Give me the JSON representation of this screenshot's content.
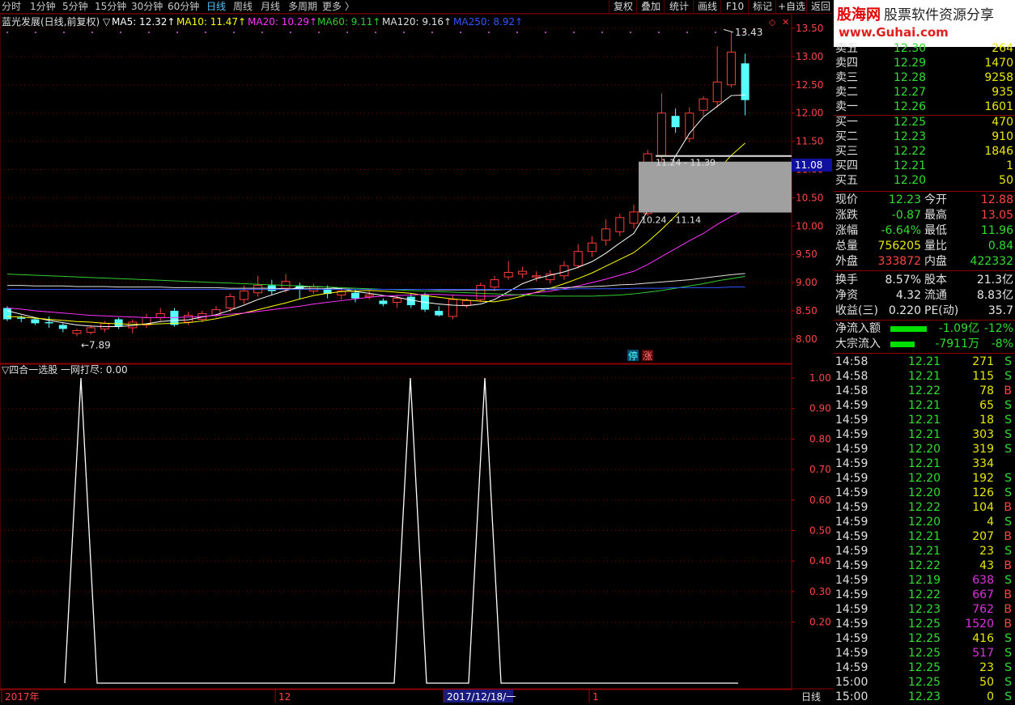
{
  "toolbar": {
    "periods": [
      "分时",
      "1分钟",
      "5分钟",
      "15分钟",
      "30分钟",
      "60分钟",
      "日线",
      "周线",
      "月线",
      "多周期",
      "更多 〉"
    ],
    "active_period": "日线",
    "buttons": [
      "复权",
      "叠加",
      "统计",
      "画线",
      "F10",
      "标记",
      "+自选",
      "返回"
    ]
  },
  "logo": {
    "brand": "股海网",
    "slogan": "股票软件资源分享",
    "url": "www.Guhai.com"
  },
  "chart_header": {
    "title": "蓝光发展(日线,前复权) ▽",
    "ma": [
      {
        "label": "MA5: 12.32↑",
        "color": "#ffffff"
      },
      {
        "label": "MA10: 11.47↑",
        "color": "#ffff00"
      },
      {
        "label": "MA20: 10.29↑",
        "color": "#ff33ff"
      },
      {
        "label": "MA60: 9.11↑",
        "color": "#33cc33"
      },
      {
        "label": "MA120: 9.16↑",
        "color": "#e0e0e0"
      },
      {
        "label": "MA250: 8.92↑",
        "color": "#3355ff"
      }
    ]
  },
  "chart_annotations": {
    "high_label": "13.43",
    "low_label": "←7.89",
    "price_marker": "11.08",
    "zone_top_label": "11.24 - 11.39",
    "zone_bottom_label": "10.24 - 11.14",
    "badge_stop": "停",
    "badge_rise": "涨"
  },
  "chart_data": [
    {
      "type": "candlestick",
      "title": "蓝光发展(日线,前复权)",
      "yticks": [
        "13.50",
        "13.00",
        "12.50",
        "12.00",
        "11.50",
        "11.00",
        "10.50",
        "10.00",
        "9.50",
        "9.00",
        "8.50",
        "8.00"
      ],
      "ylim": [
        7.8,
        13.6
      ],
      "x_labels": [
        "2017年",
        "12",
        "2017/12/18/一",
        "1"
      ],
      "candles": [
        [
          8.55,
          8.35,
          8.58,
          8.32
        ],
        [
          8.38,
          8.36,
          8.42,
          8.3
        ],
        [
          8.35,
          8.28,
          8.38,
          8.25
        ],
        [
          8.3,
          8.28,
          8.4,
          8.2
        ],
        [
          8.25,
          8.18,
          8.28,
          8.12
        ],
        [
          8.1,
          8.15,
          8.18,
          8.05
        ],
        [
          8.12,
          8.2,
          8.25,
          8.08
        ],
        [
          8.18,
          8.28,
          8.32,
          8.12
        ],
        [
          8.35,
          8.22,
          8.38,
          8.18
        ],
        [
          8.2,
          8.3,
          8.35,
          8.1
        ],
        [
          8.25,
          8.38,
          8.45,
          8.2
        ],
        [
          8.38,
          8.45,
          8.55,
          8.32
        ],
        [
          8.5,
          8.25,
          8.55,
          8.22
        ],
        [
          8.3,
          8.42,
          8.48,
          8.25
        ],
        [
          8.35,
          8.45,
          8.5,
          8.3
        ],
        [
          8.42,
          8.52,
          8.58,
          8.38
        ],
        [
          8.55,
          8.75,
          8.8,
          8.48
        ],
        [
          8.7,
          8.85,
          8.95,
          8.62
        ],
        [
          8.82,
          8.95,
          9.12,
          8.75
        ],
        [
          8.95,
          8.85,
          9.05,
          8.78
        ],
        [
          8.9,
          9.02,
          9.15,
          8.82
        ],
        [
          8.95,
          8.88,
          9.0,
          8.7
        ],
        [
          8.85,
          8.92,
          8.98,
          8.8
        ],
        [
          8.9,
          8.8,
          8.95,
          8.72
        ],
        [
          8.78,
          8.85,
          8.92,
          8.7
        ],
        [
          8.82,
          8.72,
          8.88,
          8.65
        ],
        [
          8.75,
          8.78,
          8.85,
          8.7
        ],
        [
          8.68,
          8.62,
          8.72,
          8.58
        ],
        [
          8.65,
          8.72,
          8.78,
          8.55
        ],
        [
          8.75,
          8.6,
          8.8,
          8.55
        ],
        [
          8.78,
          8.52,
          8.82,
          8.48
        ],
        [
          8.5,
          8.42,
          8.58,
          8.4
        ],
        [
          8.4,
          8.7,
          8.78,
          8.35
        ],
        [
          8.6,
          8.68,
          8.72,
          8.55
        ],
        [
          8.7,
          8.95,
          9.0,
          8.65
        ],
        [
          8.92,
          9.05,
          9.12,
          8.85
        ],
        [
          9.1,
          9.18,
          9.38,
          9.05
        ],
        [
          9.15,
          9.2,
          9.28,
          9.08
        ],
        [
          9.1,
          9.12,
          9.2,
          9.02
        ],
        [
          9.05,
          9.15,
          9.22,
          8.98
        ],
        [
          9.12,
          9.3,
          9.38,
          9.05
        ],
        [
          9.3,
          9.55,
          9.68,
          9.25
        ],
        [
          9.55,
          9.7,
          9.82,
          9.45
        ],
        [
          9.75,
          9.95,
          10.12,
          9.65
        ],
        [
          9.9,
          10.15,
          10.22,
          9.82
        ],
        [
          10.05,
          10.25,
          10.38,
          9.95
        ],
        [
          10.22,
          11.28,
          11.35,
          10.18
        ],
        [
          11.25,
          12.0,
          12.35,
          11.1
        ],
        [
          11.95,
          11.75,
          12.08,
          11.65
        ],
        [
          11.55,
          12.0,
          12.1,
          11.48
        ],
        [
          12.05,
          12.25,
          12.3,
          11.95
        ],
        [
          12.2,
          12.55,
          13.18,
          12.1
        ],
        [
          12.5,
          13.08,
          13.43,
          12.45
        ],
        [
          12.88,
          12.23,
          13.05,
          11.96
        ]
      ],
      "series": [
        {
          "name": "MA5",
          "values": [
            8.5,
            8.44,
            8.38,
            8.33,
            8.29,
            8.25,
            8.23,
            8.22,
            8.22,
            8.24,
            8.27,
            8.31,
            8.33,
            8.34,
            8.39,
            8.43,
            8.51,
            8.6,
            8.7,
            8.78,
            8.86,
            8.92,
            8.93,
            8.92,
            8.89,
            8.84,
            8.81,
            8.77,
            8.74,
            8.69,
            8.65,
            8.62,
            8.6,
            8.59,
            8.62,
            8.7,
            8.84,
            8.98,
            9.07,
            9.13,
            9.19,
            9.27,
            9.37,
            9.52,
            9.7,
            9.87,
            10.27,
            10.81,
            11.24,
            11.64,
            11.93,
            12.12,
            12.31,
            12.32
          ]
        },
        {
          "name": "MA10",
          "values": [
            8.4,
            8.39,
            8.37,
            8.35,
            8.33,
            8.31,
            8.3,
            8.28,
            8.27,
            8.26,
            8.26,
            8.27,
            8.28,
            8.29,
            8.32,
            8.36,
            8.41,
            8.46,
            8.52,
            8.58,
            8.64,
            8.71,
            8.77,
            8.81,
            8.84,
            8.85,
            8.86,
            8.85,
            8.83,
            8.81,
            8.77,
            8.74,
            8.71,
            8.69,
            8.67,
            8.66,
            8.7,
            8.76,
            8.83,
            8.9,
            8.98,
            9.07,
            9.17,
            9.29,
            9.41,
            9.53,
            9.72,
            9.94,
            10.18,
            10.43,
            10.66,
            10.98,
            11.25,
            11.47
          ]
        },
        {
          "name": "MA20",
          "values": [
            8.55,
            8.53,
            8.5,
            8.48,
            8.46,
            8.44,
            8.42,
            8.41,
            8.4,
            8.39,
            8.38,
            8.38,
            8.38,
            8.39,
            8.4,
            8.42,
            8.44,
            8.46,
            8.49,
            8.52,
            8.55,
            8.58,
            8.62,
            8.65,
            8.68,
            8.71,
            8.74,
            8.76,
            8.77,
            8.78,
            8.79,
            8.79,
            8.78,
            8.77,
            8.76,
            8.76,
            8.77,
            8.79,
            8.82,
            8.85,
            8.89,
            8.94,
            9.0,
            9.06,
            9.13,
            9.2,
            9.32,
            9.46,
            9.6,
            9.74,
            9.87,
            10.03,
            10.17,
            10.29
          ]
        },
        {
          "name": "MA60",
          "values": [
            9.15,
            9.14,
            9.13,
            9.12,
            9.11,
            9.1,
            9.09,
            9.08,
            9.07,
            9.06,
            9.05,
            9.04,
            9.03,
            9.02,
            9.01,
            9.0,
            8.99,
            8.98,
            8.97,
            8.96,
            8.95,
            8.94,
            8.93,
            8.92,
            8.91,
            8.9,
            8.89,
            8.88,
            8.87,
            8.86,
            8.85,
            8.84,
            8.83,
            8.82,
            8.81,
            8.8,
            8.79,
            8.78,
            8.77,
            8.76,
            8.76,
            8.76,
            8.76,
            8.77,
            8.78,
            8.8,
            8.83,
            8.86,
            8.9,
            8.94,
            8.98,
            9.03,
            9.07,
            9.11
          ]
        },
        {
          "name": "MA120",
          "values": [
            8.95,
            8.95,
            8.94,
            8.94,
            8.94,
            8.93,
            8.93,
            8.93,
            8.92,
            8.92,
            8.92,
            8.92,
            8.91,
            8.91,
            8.91,
            8.91,
            8.9,
            8.9,
            8.9,
            8.9,
            8.89,
            8.89,
            8.89,
            8.89,
            8.89,
            8.88,
            8.88,
            8.88,
            8.88,
            8.88,
            8.88,
            8.87,
            8.87,
            8.87,
            8.87,
            8.87,
            8.88,
            8.88,
            8.89,
            8.9,
            8.91,
            8.92,
            8.93,
            8.94,
            8.96,
            8.97,
            8.99,
            9.01,
            9.03,
            9.05,
            9.08,
            9.11,
            9.14,
            9.16
          ]
        },
        {
          "name": "MA250",
          "values": [
            8.88,
            8.88,
            8.88,
            8.88,
            8.88,
            8.88,
            8.88,
            8.88,
            8.88,
            8.88,
            8.88,
            8.88,
            8.88,
            8.88,
            8.88,
            8.88,
            8.88,
            8.88,
            8.88,
            8.88,
            8.88,
            8.88,
            8.88,
            8.88,
            8.88,
            8.88,
            8.88,
            8.88,
            8.88,
            8.88,
            8.88,
            8.88,
            8.88,
            8.88,
            8.88,
            8.88,
            8.88,
            8.88,
            8.88,
            8.88,
            8.88,
            8.89,
            8.89,
            8.89,
            8.89,
            8.9,
            8.9,
            8.9,
            8.91,
            8.91,
            8.91,
            8.91,
            8.92,
            8.92
          ]
        }
      ]
    },
    {
      "type": "line",
      "title": "四合一选股 一网打尽: 0.00",
      "yticks": [
        "1.00",
        "0.90",
        "0.80",
        "0.70",
        "0.60",
        "0.50",
        "0.40",
        "0.30",
        "0.20"
      ],
      "ylim": [
        0,
        1.05
      ],
      "series": [
        {
          "name": "一网打尽",
          "values": [
            0,
            0,
            1,
            0,
            0,
            0,
            0,
            0,
            0,
            0,
            0,
            0,
            0,
            0,
            1,
            0,
            0,
            1,
            0,
            0,
            0,
            0,
            0,
            0,
            0,
            0,
            0,
            0,
            0,
            0,
            0,
            0,
            0,
            0,
            0,
            0
          ]
        }
      ]
    }
  ],
  "indicator": {
    "title": "▽四合一选股 一网打尽: 0.00"
  },
  "bottom_axis": {
    "labels": [
      "2017年",
      "12",
      "2017/12/18/一",
      "1"
    ],
    "period_tag": "日线"
  },
  "order_book": {
    "sells": [
      {
        "label": "卖五",
        "price": "12.30",
        "vol": "264"
      },
      {
        "label": "卖四",
        "price": "12.29",
        "vol": "1470"
      },
      {
        "label": "卖三",
        "price": "12.28",
        "vol": "9258"
      },
      {
        "label": "卖二",
        "price": "12.27",
        "vol": "935"
      },
      {
        "label": "卖一",
        "price": "12.26",
        "vol": "1601"
      }
    ],
    "buys": [
      {
        "label": "买一",
        "price": "12.25",
        "vol": "470"
      },
      {
        "label": "买二",
        "price": "12.23",
        "vol": "910"
      },
      {
        "label": "买三",
        "price": "12.22",
        "vol": "1846"
      },
      {
        "label": "买四",
        "price": "12.21",
        "vol": "1"
      },
      {
        "label": "买五",
        "price": "12.20",
        "vol": "50"
      }
    ]
  },
  "quote": [
    {
      "k1": "现价",
      "v1": "12.23",
      "c1": "#33dd33",
      "k2": "今开",
      "v2": "12.88",
      "c2": "#ff4444"
    },
    {
      "k1": "涨跌",
      "v1": "-0.87",
      "c1": "#33dd33",
      "k2": "最高",
      "v2": "13.05",
      "c2": "#ff4444"
    },
    {
      "k1": "涨幅",
      "v1": "-6.64%",
      "c1": "#33dd33",
      "k2": "最低",
      "v2": "11.96",
      "c2": "#33dd33"
    },
    {
      "k1": "总量",
      "v1": "756205",
      "c1": "#e8e800",
      "k2": "量比",
      "v2": "0.84",
      "c2": "#33dd33"
    },
    {
      "k1": "外盘",
      "v1": "333872",
      "c1": "#ff4444",
      "k2": "内盘",
      "v2": "422332",
      "c2": "#33dd33"
    },
    {
      "k1": "换手",
      "v1": "8.57%",
      "c1": "#e8e8e8",
      "k2": "股本",
      "v2": "21.3亿",
      "c2": "#e8e8e8"
    },
    {
      "k1": "净资",
      "v1": "4.32",
      "c1": "#e8e8e8",
      "k2": "流通",
      "v2": "8.83亿",
      "c2": "#e8e8e8"
    },
    {
      "k1": "收益(三)",
      "v1": "0.220",
      "c1": "#e8e8e8",
      "k2": "PE(动)",
      "v2": "35.7",
      "c2": "#e8e8e8"
    }
  ],
  "flow": [
    {
      "label": "净流入额",
      "value": "-1.09亿",
      "pct": "-12%",
      "bar": 0.9
    },
    {
      "label": "大宗流入",
      "value": "-7911万",
      "pct": "-8%",
      "bar": 0.6
    }
  ],
  "ticks": [
    {
      "t": "14:58",
      "p": "12.21",
      "v": "271",
      "d": "S"
    },
    {
      "t": "14:58",
      "p": "12.21",
      "v": "115",
      "d": "S"
    },
    {
      "t": "14:58",
      "p": "12.22",
      "v": "78",
      "d": "B"
    },
    {
      "t": "14:59",
      "p": "12.21",
      "v": "65",
      "d": "S"
    },
    {
      "t": "14:59",
      "p": "12.21",
      "v": "18",
      "d": "S"
    },
    {
      "t": "14:59",
      "p": "12.21",
      "v": "303",
      "d": "S"
    },
    {
      "t": "14:59",
      "p": "12.20",
      "v": "319",
      "d": "S"
    },
    {
      "t": "14:59",
      "p": "12.21",
      "v": "334",
      "d": ""
    },
    {
      "t": "14:59",
      "p": "12.20",
      "v": "192",
      "d": "S"
    },
    {
      "t": "14:59",
      "p": "12.20",
      "v": "126",
      "d": "S"
    },
    {
      "t": "14:59",
      "p": "12.22",
      "v": "104",
      "d": "B"
    },
    {
      "t": "14:59",
      "p": "12.20",
      "v": "4",
      "d": "S"
    },
    {
      "t": "14:59",
      "p": "12.21",
      "v": "207",
      "d": "B"
    },
    {
      "t": "14:59",
      "p": "12.21",
      "v": "23",
      "d": "S"
    },
    {
      "t": "14:59",
      "p": "12.22",
      "v": "43",
      "d": "B"
    },
    {
      "t": "14:59",
      "p": "12.19",
      "v": "638",
      "d": "S"
    },
    {
      "t": "14:59",
      "p": "12.22",
      "v": "667",
      "d": "B"
    },
    {
      "t": "14:59",
      "p": "12.23",
      "v": "762",
      "d": "B"
    },
    {
      "t": "14:59",
      "p": "12.25",
      "v": "1520",
      "d": "B"
    },
    {
      "t": "14:59",
      "p": "12.25",
      "v": "416",
      "d": "S"
    },
    {
      "t": "14:59",
      "p": "12.25",
      "v": "517",
      "d": "S"
    },
    {
      "t": "14:59",
      "p": "12.25",
      "v": "23",
      "d": "S"
    },
    {
      "t": "15:00",
      "p": "12.25",
      "v": "50",
      "d": "S"
    },
    {
      "t": "15:00",
      "p": "12.23",
      "v": "0",
      "d": "S"
    }
  ]
}
